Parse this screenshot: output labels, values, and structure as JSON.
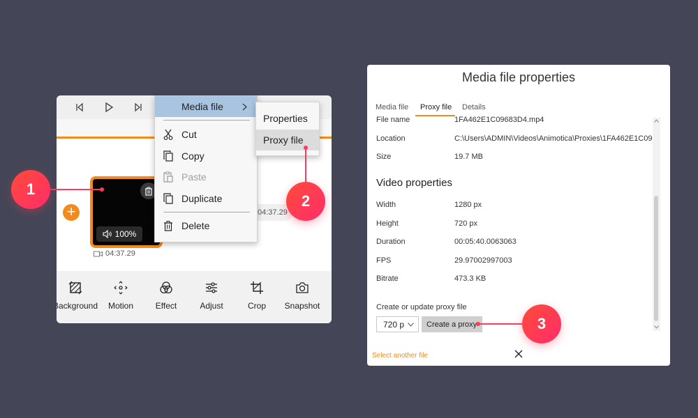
{
  "editor": {
    "clip_volume": "100%",
    "clip_duration": "04:37.29",
    "clip2_duration": "04:37.29",
    "tools": [
      {
        "label": "Background",
        "icon": "background-icon"
      },
      {
        "label": "Motion",
        "icon": "motion-icon"
      },
      {
        "label": "Effect",
        "icon": "effect-icon"
      },
      {
        "label": "Adjust",
        "icon": "adjust-icon"
      },
      {
        "label": "Crop",
        "icon": "crop-icon"
      },
      {
        "label": "Snapshot",
        "icon": "snapshot-icon"
      }
    ]
  },
  "context_menu": {
    "items": [
      {
        "label": "Media file",
        "icon": "",
        "highlighted": true
      },
      {
        "label": "Cut",
        "icon": "scissors-icon"
      },
      {
        "label": "Copy",
        "icon": "copy-icon"
      },
      {
        "label": "Paste",
        "icon": "paste-icon",
        "disabled": true
      },
      {
        "label": "Duplicate",
        "icon": "duplicate-icon"
      },
      {
        "label": "Delete",
        "icon": "trash-icon"
      }
    ]
  },
  "submenu": {
    "items": [
      {
        "label": "Properties"
      },
      {
        "label": "Proxy file",
        "highlighted": true
      }
    ]
  },
  "callouts": [
    "1",
    "2",
    "3"
  ],
  "dialog": {
    "title": "Media file properties",
    "tabs": [
      "Media file",
      "Proxy file",
      "Details"
    ],
    "active_tab": "Proxy file",
    "file_props": [
      {
        "label": "File name",
        "value": "1FA462E1C09683D4.mp4"
      },
      {
        "label": "Location",
        "value": "C:\\Users\\ADMIN\\Videos\\Animotica\\Proxies\\1FA462E1C09"
      },
      {
        "label": "Size",
        "value": "19.7 MB"
      }
    ],
    "video_section_title": "Video properties",
    "video_props": [
      {
        "label": "Width",
        "value": "1280 px"
      },
      {
        "label": "Height",
        "value": "720 px"
      },
      {
        "label": "Duration",
        "value": "00:05:40.0063063"
      },
      {
        "label": "FPS",
        "value": "29.97002997003"
      },
      {
        "label": "Bitrate",
        "value": "473.3 KB"
      }
    ],
    "proxy_label": "Create or update proxy file",
    "resolution": "720 p",
    "create_button": "Create a proxy",
    "select_another": "Select another file"
  },
  "colors": {
    "background": "#444658",
    "accent": "#f28b1c",
    "callout": "#ff3a5a"
  }
}
